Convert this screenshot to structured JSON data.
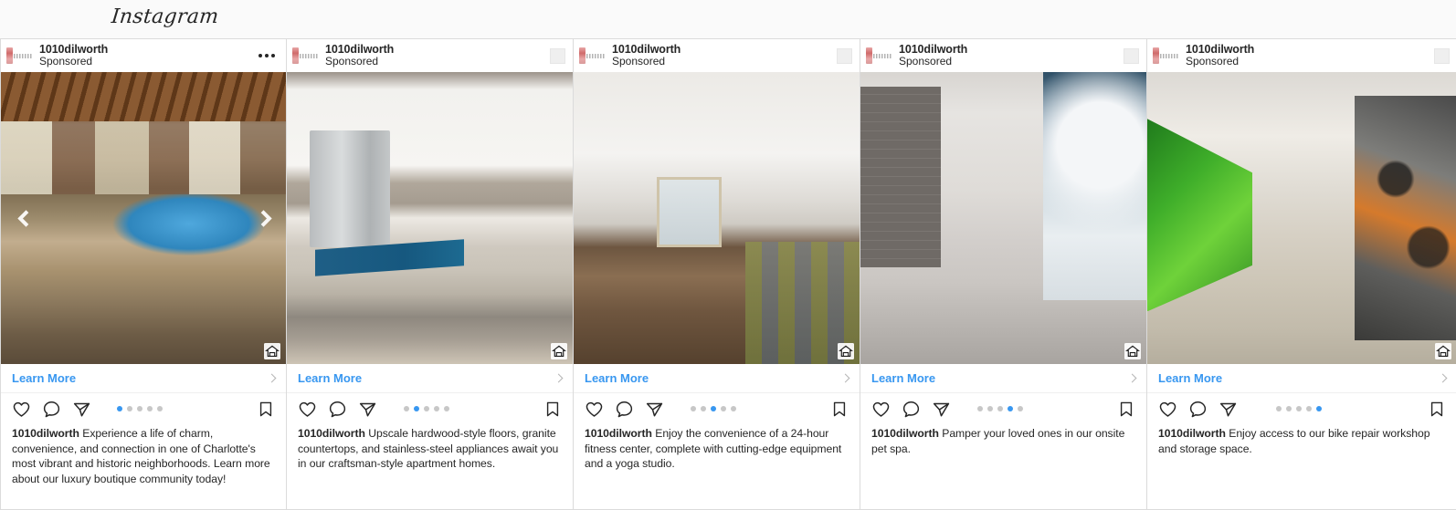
{
  "topbar": {
    "logo_text": "Instagram",
    "background": "#fafafa"
  },
  "theme": {
    "link_blue": "#3897f0",
    "text_dark": "#262626",
    "border_gray": "#dbdbdb",
    "dot_inactive": "#c7c7c7"
  },
  "carousel": {
    "total_slides": 5,
    "prev_arrow": "chevron-left",
    "next_arrow": "chevron-right"
  },
  "cards": [
    {
      "account": "1010dilworth",
      "sponsored_label": "Sponsored",
      "menu": "more-options",
      "scene": "scene-pool",
      "scene_name": "courtyard-pool-photo",
      "badge": "equal-housing-opportunity",
      "cta_label": "Learn More",
      "active_dot": 1,
      "caption_user": "1010dilworth",
      "caption_text": " Experience a life of charm, convenience, and connection in one of Charlotte's most vibrant and historic neighborhoods. Learn more about our luxury boutique community today!",
      "show_arrows": true
    },
    {
      "account": "1010dilworth",
      "sponsored_label": "Sponsored",
      "menu": "placeholder",
      "scene": "scene-kitchen",
      "scene_name": "kitchen-interior-photo",
      "badge": "equal-housing-opportunity",
      "cta_label": "Learn More",
      "active_dot": 2,
      "caption_user": "1010dilworth",
      "caption_text": " Upscale hardwood-style floors, granite countertops, and stainless-steel appliances await you in our craftsman-style apartment homes.",
      "show_arrows": false
    },
    {
      "account": "1010dilworth",
      "sponsored_label": "Sponsored",
      "menu": "placeholder",
      "scene": "scene-gym",
      "scene_name": "fitness-center-photo",
      "badge": "equal-housing-opportunity",
      "cta_label": "Learn More",
      "active_dot": 3,
      "caption_user": "1010dilworth",
      "caption_text": " Enjoy the convenience of a 24-hour fitness center, complete with cutting-edge equipment and a yoga studio.",
      "show_arrows": false
    },
    {
      "account": "1010dilworth",
      "sponsored_label": "Sponsored",
      "menu": "placeholder",
      "scene": "scene-pet",
      "scene_name": "pet-spa-photo",
      "badge": "equal-housing-opportunity",
      "cta_label": "Learn More",
      "active_dot": 4,
      "caption_user": "1010dilworth",
      "caption_text": " Pamper your loved ones in our onsite pet spa.",
      "show_arrows": false
    },
    {
      "account": "1010dilworth",
      "sponsored_label": "Sponsored",
      "menu": "placeholder",
      "scene": "scene-bike",
      "scene_name": "bike-storage-photo",
      "badge": "equal-housing-opportunity",
      "cta_label": "Learn More",
      "active_dot": 5,
      "caption_user": "1010dilworth",
      "caption_text": " Enjoy access to our bike repair workshop and storage space.",
      "show_arrows": false
    }
  ],
  "icons": {
    "like": "heart-icon",
    "comment": "comment-icon",
    "share": "share-icon",
    "save": "bookmark-icon"
  }
}
